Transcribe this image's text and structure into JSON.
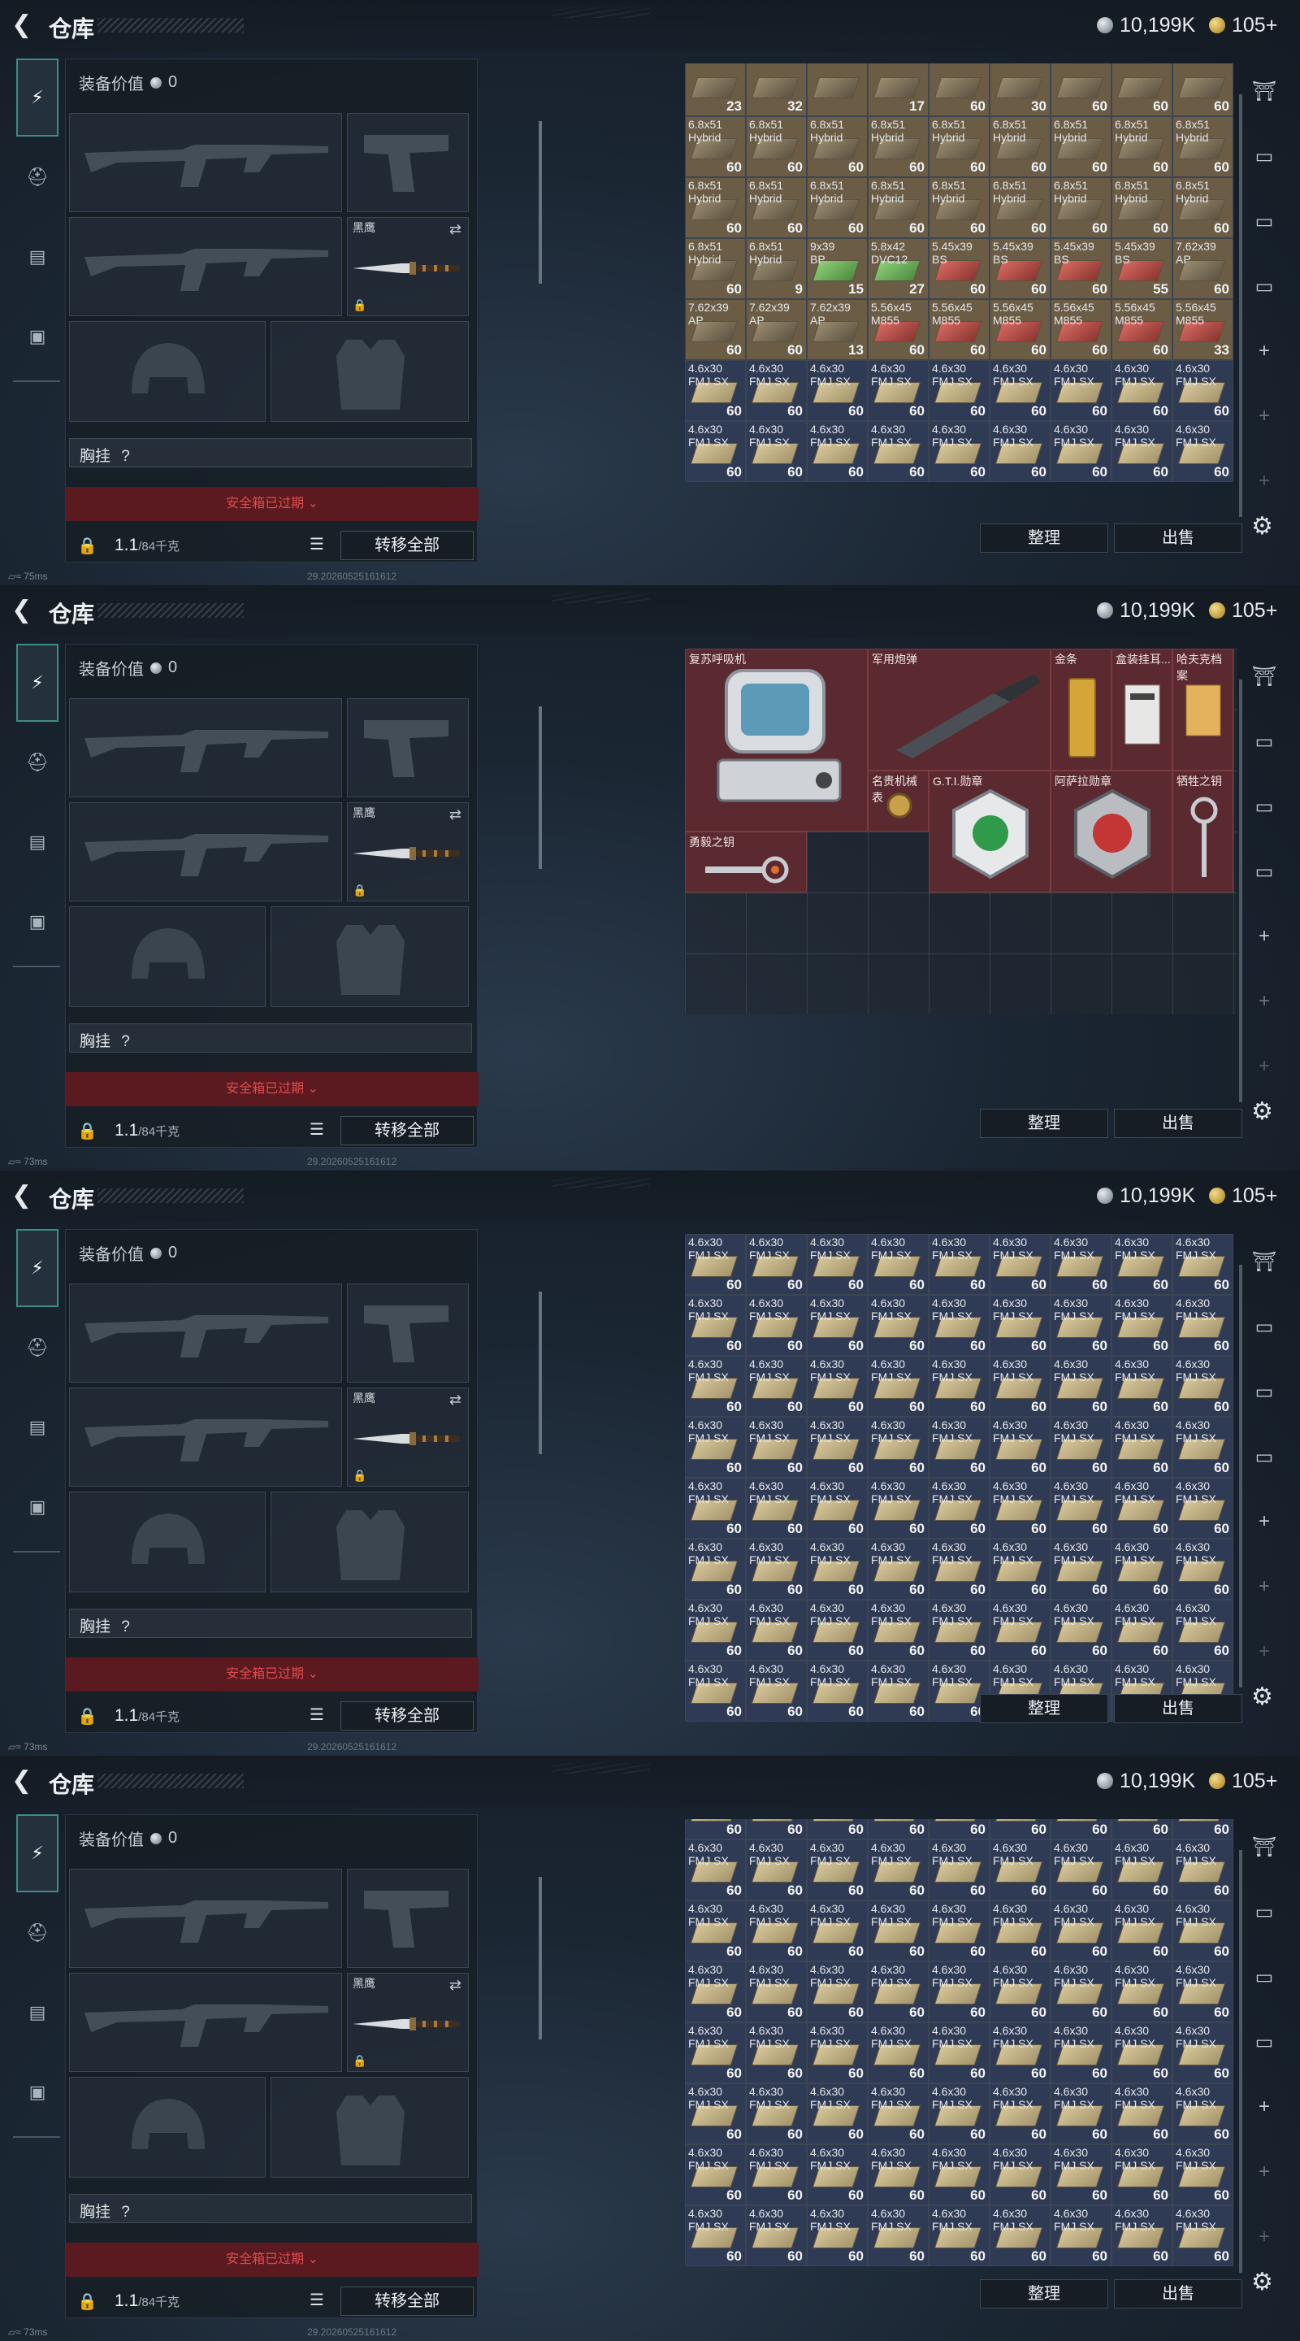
{
  "header": {
    "title": "仓库",
    "silver_amount": "10,199K",
    "gold_amount": "105+"
  },
  "equipment": {
    "value_label": "装备价值",
    "value": "0",
    "melee_label": "黑鹰",
    "chest_rig_label": "胸挂",
    "chest_rig_value": "?",
    "safe_box_status": "安全箱已过期",
    "weight_current": "1.1",
    "weight_max": "/84千克",
    "transfer_all": "转移全部"
  },
  "inventory_actions": {
    "sort": "整理",
    "sell": "出售"
  },
  "status": {
    "ping_1": "75ms",
    "ping_2": "73ms",
    "build_id": "29.20260525161612"
  },
  "panel1_cells": [
    {
      "name": "",
      "count": "23",
      "color": "brown",
      "box": "darkbox"
    },
    {
      "name": "",
      "count": "32",
      "color": "brown",
      "box": "darkbox"
    },
    {
      "name": "",
      "count": "",
      "color": "brown",
      "box": "darkbox"
    },
    {
      "name": "",
      "count": "17",
      "color": "brown",
      "box": "darkbox"
    },
    {
      "name": "",
      "count": "60",
      "color": "brown",
      "box": "darkbox"
    },
    {
      "name": "",
      "count": "30",
      "color": "brown",
      "box": "darkbox"
    },
    {
      "name": "",
      "count": "60",
      "color": "brown",
      "box": "darkbox"
    },
    {
      "name": "",
      "count": "60",
      "color": "brown",
      "box": "darkbox"
    },
    {
      "name": "",
      "count": "60",
      "color": "brown",
      "box": "darkbox"
    },
    {
      "name": "6.8x51\nHybrid",
      "count": "60",
      "color": "brown",
      "box": "darkbox"
    },
    {
      "name": "6.8x51\nHybrid",
      "count": "60",
      "color": "brown",
      "box": "darkbox"
    },
    {
      "name": "6.8x51\nHybrid",
      "count": "60",
      "color": "brown",
      "box": "darkbox"
    },
    {
      "name": "6.8x51\nHybrid",
      "count": "60",
      "color": "brown",
      "box": "darkbox"
    },
    {
      "name": "6.8x51\nHybrid",
      "count": "60",
      "color": "brown",
      "box": "darkbox"
    },
    {
      "name": "6.8x51\nHybrid",
      "count": "60",
      "color": "brown",
      "box": "darkbox"
    },
    {
      "name": "6.8x51\nHybrid",
      "count": "60",
      "color": "brown",
      "box": "darkbox"
    },
    {
      "name": "6.8x51\nHybrid",
      "count": "60",
      "color": "brown",
      "box": "darkbox"
    },
    {
      "name": "6.8x51\nHybrid",
      "count": "60",
      "color": "brown",
      "box": "darkbox"
    },
    {
      "name": "6.8x51\nHybrid",
      "count": "60",
      "color": "brown",
      "box": "darkbox"
    },
    {
      "name": "6.8x51\nHybrid",
      "count": "60",
      "color": "brown",
      "box": "darkbox"
    },
    {
      "name": "6.8x51\nHybrid",
      "count": "60",
      "color": "brown",
      "box": "darkbox"
    },
    {
      "name": "6.8x51\nHybrid",
      "count": "60",
      "color": "brown",
      "box": "darkbox"
    },
    {
      "name": "6.8x51\nHybrid",
      "count": "60",
      "color": "brown",
      "box": "darkbox"
    },
    {
      "name": "6.8x51\nHybrid",
      "count": "60",
      "color": "brown",
      "box": "darkbox"
    },
    {
      "name": "6.8x51\nHybrid",
      "count": "60",
      "color": "brown",
      "box": "darkbox"
    },
    {
      "name": "6.8x51\nHybrid",
      "count": "60",
      "color": "brown",
      "box": "darkbox"
    },
    {
      "name": "6.8x51\nHybrid",
      "count": "60",
      "color": "brown",
      "box": "darkbox"
    },
    {
      "name": "6.8x51\nHybrid",
      "count": "60",
      "color": "brown",
      "box": "darkbox"
    },
    {
      "name": "6.8x51\nHybrid",
      "count": "9",
      "color": "brown",
      "box": "darkbox"
    },
    {
      "name": "9x39\nBP",
      "count": "15",
      "color": "brown",
      "box": "green"
    },
    {
      "name": "5.8x42\nDVC12",
      "count": "27",
      "color": "brown",
      "box": "green"
    },
    {
      "name": "5.45x39\nBS",
      "count": "60",
      "color": "brown",
      "box": "redbox"
    },
    {
      "name": "5.45x39\nBS",
      "count": "60",
      "color": "brown",
      "box": "redbox"
    },
    {
      "name": "5.45x39\nBS",
      "count": "60",
      "color": "brown",
      "box": "redbox"
    },
    {
      "name": "5.45x39\nBS",
      "count": "55",
      "color": "brown",
      "box": "redbox"
    },
    {
      "name": "7.62x39\nAP",
      "count": "60",
      "color": "brown",
      "box": "darkbox"
    },
    {
      "name": "7.62x39\nAP",
      "count": "60",
      "color": "brown",
      "box": "darkbox"
    },
    {
      "name": "7.62x39\nAP",
      "count": "60",
      "color": "brown",
      "box": "darkbox"
    },
    {
      "name": "7.62x39\nAP",
      "count": "13",
      "color": "brown",
      "box": "darkbox"
    },
    {
      "name": "5.56x45\nM855",
      "count": "60",
      "color": "brown",
      "box": "redbox"
    },
    {
      "name": "5.56x45\nM855",
      "count": "60",
      "color": "brown",
      "box": "redbox"
    },
    {
      "name": "5.56x45\nM855",
      "count": "60",
      "color": "brown",
      "box": "redbox"
    },
    {
      "name": "5.56x45\nM855",
      "count": "60",
      "color": "brown",
      "box": "redbox"
    },
    {
      "name": "5.56x45\nM855",
      "count": "60",
      "color": "brown",
      "box": "redbox"
    },
    {
      "name": "5.56x45\nM855",
      "count": "33",
      "color": "brown",
      "box": "redbox"
    },
    {
      "name": "4.6x30\nFMJ SX",
      "count": "60",
      "color": "navy",
      "box": ""
    },
    {
      "name": "4.6x30\nFMJ SX",
      "count": "60",
      "color": "navy",
      "box": ""
    },
    {
      "name": "4.6x30\nFMJ SX",
      "count": "60",
      "color": "navy",
      "box": ""
    },
    {
      "name": "4.6x30\nFMJ SX",
      "count": "60",
      "color": "navy",
      "box": ""
    },
    {
      "name": "4.6x30\nFMJ SX",
      "count": "60",
      "color": "navy",
      "box": ""
    },
    {
      "name": "4.6x30\nFMJ SX",
      "count": "60",
      "color": "navy",
      "box": ""
    },
    {
      "name": "4.6x30\nFMJ SX",
      "count": "60",
      "color": "navy",
      "box": ""
    },
    {
      "name": "4.6x30\nFMJ SX",
      "count": "60",
      "color": "navy",
      "box": ""
    },
    {
      "name": "4.6x30\nFMJ SX",
      "count": "60",
      "color": "navy",
      "box": ""
    },
    {
      "name": "4.6x30\nFMJ SX",
      "count": "60",
      "color": "navy",
      "box": ""
    },
    {
      "name": "4.6x30\nFMJ SX",
      "count": "60",
      "color": "navy",
      "box": ""
    },
    {
      "name": "4.6x30\nFMJ SX",
      "count": "60",
      "color": "navy",
      "box": ""
    },
    {
      "name": "4.6x30\nFMJ SX",
      "count": "60",
      "color": "navy",
      "box": ""
    },
    {
      "name": "4.6x30\nFMJ SX",
      "count": "60",
      "color": "navy",
      "box": ""
    },
    {
      "name": "4.6x30\nFMJ SX",
      "count": "60",
      "color": "navy",
      "box": ""
    },
    {
      "name": "4.6x30\nFMJ SX",
      "count": "60",
      "color": "navy",
      "box": ""
    },
    {
      "name": "4.6x30\nFMJ SX",
      "count": "60",
      "color": "navy",
      "box": ""
    },
    {
      "name": "4.6x30\nFMJ SX",
      "count": "60",
      "color": "navy",
      "box": ""
    }
  ],
  "special_items": [
    {
      "key": "defibrillator",
      "name": "复苏呼吸机"
    },
    {
      "key": "military-shell",
      "name": "军用炮弹"
    },
    {
      "key": "gold-bar",
      "name": "金条"
    },
    {
      "key": "boxed-card",
      "name": "盒装挂耳..."
    },
    {
      "key": "hafuc-file",
      "name": "哈夫克档案"
    },
    {
      "key": "luxury-watch",
      "name": "名贵机械表"
    },
    {
      "key": "gti-medal",
      "name": "G.T.I.勋章"
    },
    {
      "key": "asara-medal",
      "name": "阿萨拉勋章"
    },
    {
      "key": "sacrifice-key",
      "name": "牺牲之钥"
    },
    {
      "key": "courage-key",
      "name": "勇毅之钥"
    }
  ],
  "ammo_cell": {
    "name": "4.6x30\nFMJ SX",
    "count": "60"
  },
  "panel3_visible_rows": 8,
  "panel4_visible_rows": 7
}
